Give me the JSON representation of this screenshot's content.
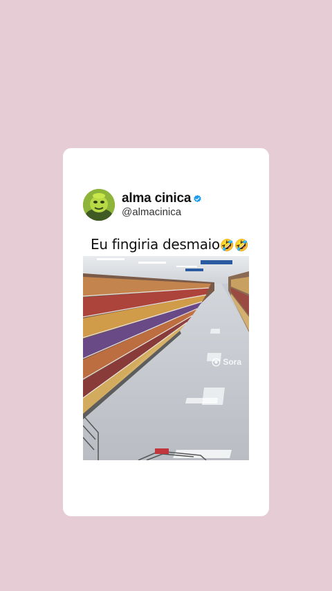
{
  "post": {
    "author_name": "alma cinica",
    "author_handle": "@almacinica",
    "verified": true,
    "text": "Eu fingiria desmaio",
    "emojis": "🤣🤣",
    "media": {
      "description_icon": "video-thumbnail",
      "watermark": "Sora"
    }
  },
  "colors": {
    "background": "#e6cdd5",
    "card": "#ffffff",
    "verified": "#1d9bf0"
  }
}
